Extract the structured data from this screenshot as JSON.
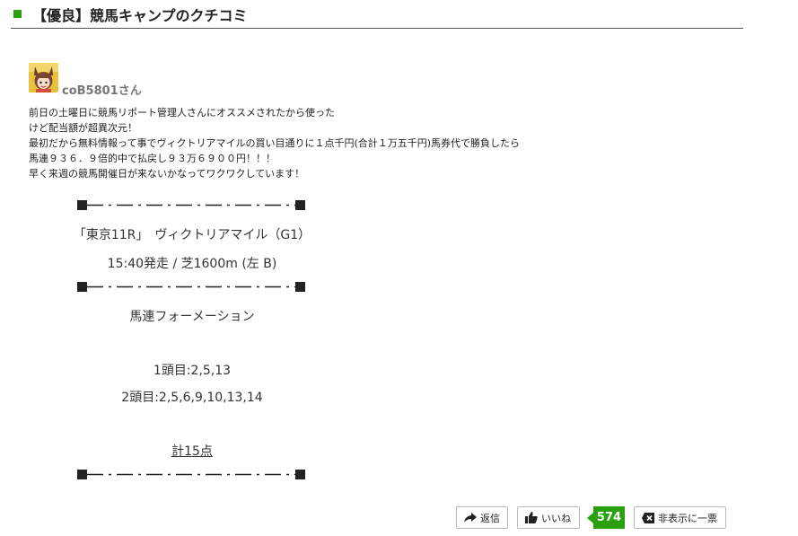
{
  "section": {
    "title": "【優良】競馬キャンプのクチコミ",
    "accent_color": "#2aa010"
  },
  "review": {
    "username": "coB5801さん",
    "avatar_icon": "avatar-character-icon",
    "body_lines": [
      "前日の土曜日に競馬リポート管理人さんにオススメされたから使った",
      "けど配当額が超異次元！",
      "最初だから無料情報って事でヴィクトリアマイルの買い目通りに１点千円(合計１万五千円)馬券代で勝負したら",
      "馬連９３６．９倍的中で払戻し９３万６９００円！！！",
      "早く来週の競馬開催日が来ないかなってワクワクしています！"
    ],
    "race_name": "「東京11R」　ヴィクトリアマイル（G1）",
    "race_detail": "15:40発走 / 芝1600m (左 B)",
    "bet_type": "馬連フォーメーション",
    "first_leg": "1頭目:2,5,13",
    "second_leg": "2頭目:2,5,6,9,10,13,14",
    "total": "計15点"
  },
  "actions": {
    "reply_label": "返信",
    "reply_icon": "reply-arrow-icon",
    "like_label": "いいね",
    "like_icon": "thumbs-up-icon",
    "like_count": "574",
    "hide_label": "非表示に一票",
    "hide_icon": "hide-x-icon"
  }
}
